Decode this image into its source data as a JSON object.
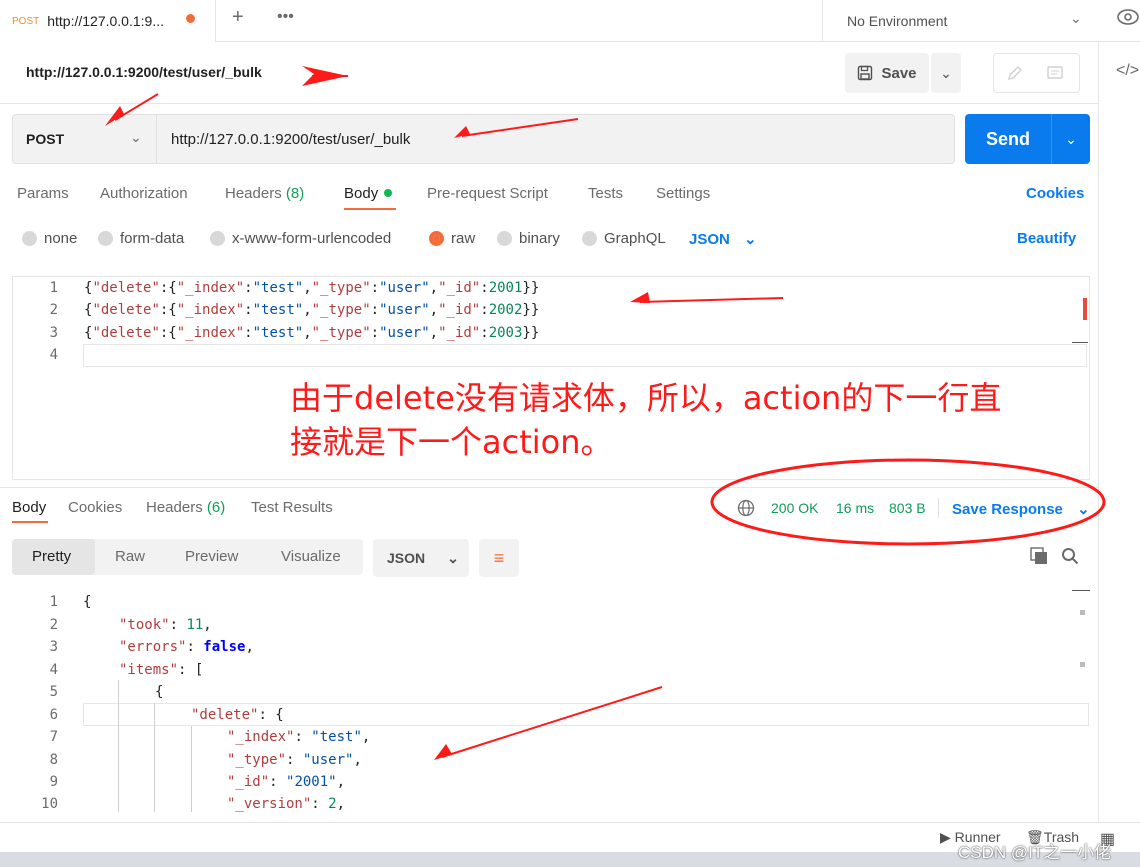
{
  "tab": {
    "method": "POST",
    "title": "http://127.0.0.1:9..."
  },
  "environment": {
    "label": "No Environment"
  },
  "request": {
    "title": "http://127.0.0.1:9200/test/user/_bulk",
    "save_label": "Save",
    "method": "POST",
    "url": "http://127.0.0.1:9200/test/user/_bulk",
    "send_label": "Send"
  },
  "request_tabs": {
    "params": "Params",
    "authorization": "Authorization",
    "headers": "Headers",
    "headers_count": "(8)",
    "body": "Body",
    "prerequest": "Pre-request Script",
    "tests": "Tests",
    "settings": "Settings",
    "cookies": "Cookies"
  },
  "body_types": {
    "none": "none",
    "form_data": "form-data",
    "urlencoded": "x-www-form-urlencoded",
    "raw": "raw",
    "binary": "binary",
    "graphql": "GraphQL",
    "format": "JSON",
    "beautify": "Beautify"
  },
  "editor_lines": [
    {
      "n": "1",
      "id": "2001"
    },
    {
      "n": "2",
      "id": "2002"
    },
    {
      "n": "3",
      "id": "2003"
    },
    {
      "n": "4",
      "id": ""
    }
  ],
  "annotation": {
    "line1": "由于delete没有请求体，所以，action的下一行直",
    "line2": "接就是下一个action。",
    "color": "#ff1a1a"
  },
  "response_tabs": {
    "body": "Body",
    "cookies": "Cookies",
    "headers": "Headers",
    "headers_count": "(6)",
    "tests": "Test Results"
  },
  "response_status": {
    "status": "200 OK",
    "time": "16 ms",
    "size": "803 B",
    "save_response": "Save Response"
  },
  "response_view": {
    "pretty": "Pretty",
    "raw": "Raw",
    "preview": "Preview",
    "visualize": "Visualize",
    "format": "JSON"
  },
  "response_lines": {
    "l1": "{",
    "took_key": "\"took\"",
    "took_val": "11",
    "errors_key": "\"errors\"",
    "errors_val": "false",
    "items_key": "\"items\"",
    "delete_key": "\"delete\"",
    "index_key": "\"_index\"",
    "index_val": "\"test\"",
    "type_key": "\"_type\"",
    "type_val": "\"user\"",
    "id_key": "\"_id\"",
    "id_val": "\"2001\"",
    "version_key": "\"_version\"",
    "version_val": "2"
  },
  "footer": {
    "runner": "Runner",
    "trash": "Trash"
  },
  "watermark": "CSDN @IT之一小佬",
  "colors": {
    "accent": "#097bed",
    "orange": "#f26b3a",
    "green": "#0f9d58",
    "arrow": "#ff1a1a"
  }
}
